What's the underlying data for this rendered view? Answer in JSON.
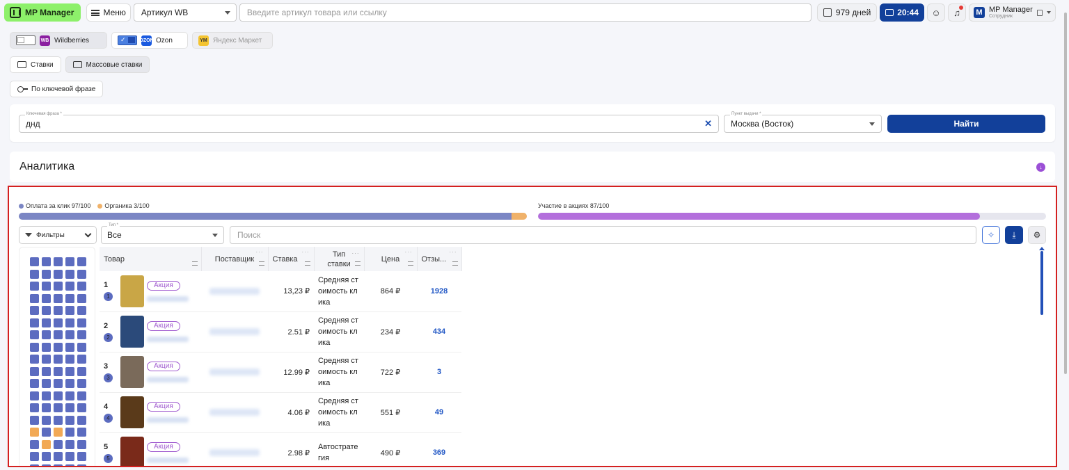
{
  "header": {
    "brand": "MP Manager",
    "menu_label": "Меню",
    "article_select": "Артикул WB",
    "search_placeholder": "Введите артикул товара или ссылку",
    "days": "979 дней",
    "timer": "20:44",
    "account_name": "MP Manager",
    "account_role": "Сотрудник",
    "avatar_letter": "M"
  },
  "marketplaces": [
    {
      "name": "Wildberries",
      "icon": "WB",
      "enabled": false
    },
    {
      "name": "Ozon",
      "icon": "OZON",
      "enabled": true
    },
    {
      "name": "Яндекс Маркет",
      "icon": "YM",
      "enabled": false
    }
  ],
  "tabs": {
    "bids": "Ставки",
    "mass_bids": "Массовые ставки",
    "by_keyword": "По ключевой фразе"
  },
  "search_form": {
    "keyword_label": "Ключевая фраза *",
    "keyword_value": "днд",
    "pickup_label": "Пункт выдачи *",
    "pickup_value": "Москва (Восток)",
    "find_label": "Найти"
  },
  "analytics": {
    "title": "Аналитика"
  },
  "stats": {
    "cpc_label": "Оплата за клик 97/100",
    "organic_label": "Органика 3/100",
    "cpc": 97,
    "organic": 3,
    "promo_label": "Участие в акциях 87/100",
    "promo": 87
  },
  "toolbar": {
    "filters_label": "Фильтры",
    "type_label": "Тип *",
    "type_value": "Все",
    "search_placeholder": "Поиск"
  },
  "table": {
    "columns": [
      "Товар",
      "Поставщик",
      "Ставка",
      "Тип ставки",
      "Цена",
      "Отзы..."
    ],
    "promo_badge": "Акция",
    "rows": [
      {
        "n": "1",
        "bid": "13,23 ₽",
        "type": "Средняя стоимость клика",
        "price": "864 ₽",
        "reviews": "1928"
      },
      {
        "n": "2",
        "bid": "2.51 ₽",
        "type": "Средняя стоимость клика",
        "price": "234 ₽",
        "reviews": "434"
      },
      {
        "n": "3",
        "bid": "12.99 ₽",
        "type": "Средняя стоимость клика",
        "price": "722 ₽",
        "reviews": "3"
      },
      {
        "n": "4",
        "bid": "4.06 ₽",
        "type": "Средняя стоимость клика",
        "price": "551 ₽",
        "reviews": "49"
      },
      {
        "n": "5",
        "bid": "2.98 ₽",
        "type": "Автостратегия",
        "price": "490 ₽",
        "reviews": "369"
      }
    ]
  },
  "colors": {
    "cpc": "#7b86c4",
    "organic": "#f0b26a",
    "promo": "#b36fdc",
    "accent": "#12409a"
  }
}
